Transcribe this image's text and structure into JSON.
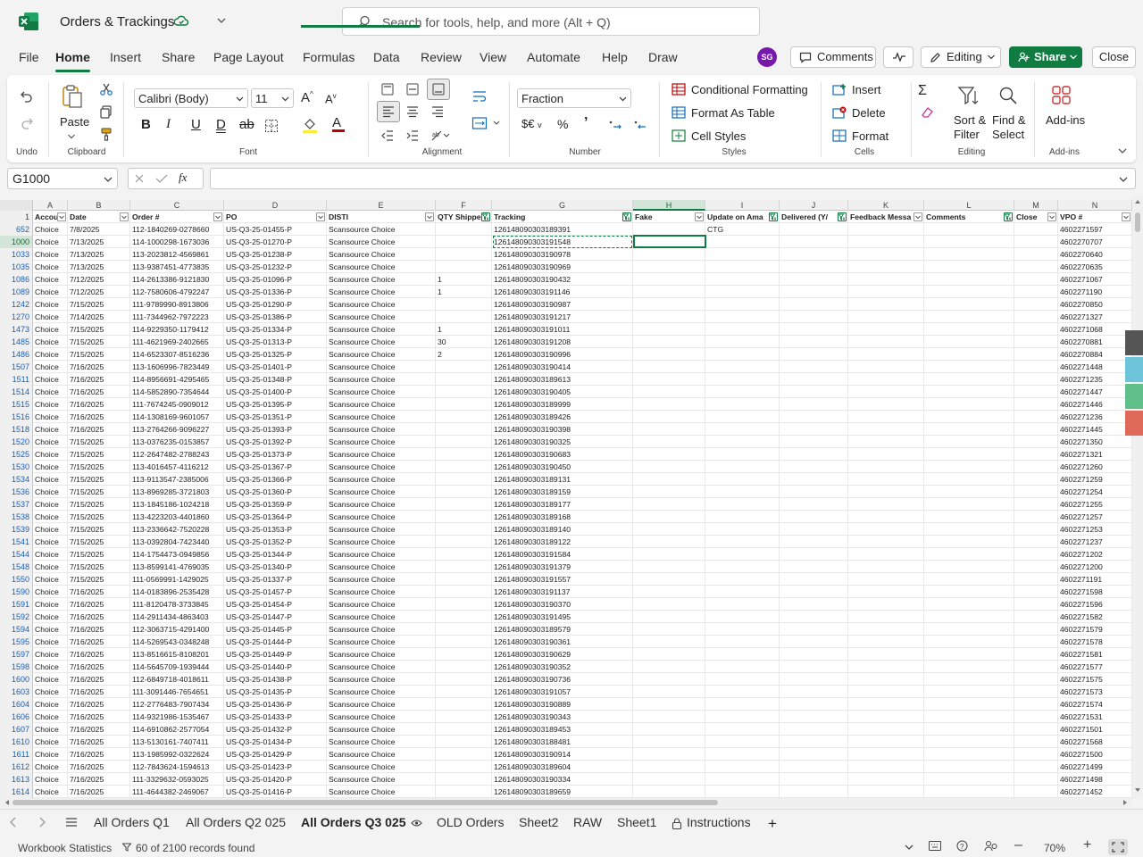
{
  "window": {
    "workbook_name": "Orders & Trackings",
    "search_placeholder": "Search for tools, help, and more (Alt + Q)"
  },
  "menu": {
    "tabs": [
      "File",
      "Home",
      "Insert",
      "Share",
      "Page Layout",
      "Formulas",
      "Data",
      "Review",
      "View",
      "Automate",
      "Help",
      "Draw"
    ],
    "active": "Home"
  },
  "header_actions": {
    "avatar": "SG",
    "comments": "Comments",
    "editing": "Editing",
    "share": "Share",
    "close": "Close"
  },
  "ribbon": {
    "undo_label": "Undo",
    "clipboard": {
      "paste": "Paste",
      "label": "Clipboard"
    },
    "font": {
      "name": "Calibri (Body)",
      "size": "11",
      "label": "Font"
    },
    "alignment": {
      "label": "Alignment"
    },
    "number": {
      "format": "Fraction",
      "label": "Number"
    },
    "styles": {
      "conditional": "Conditional Formatting",
      "format_table": "Format As Table",
      "cell_styles": "Cell Styles",
      "label": "Styles"
    },
    "cells": {
      "insert": "Insert",
      "delete": "Delete",
      "format": "Format",
      "label": "Cells"
    },
    "editing": {
      "sort_1": "Sort &",
      "sort_2": "Filter",
      "find_1": "Find &",
      "find_2": "Select",
      "label": "Editing"
    },
    "addins": {
      "name": "Add-ins",
      "label": "Add-ins"
    }
  },
  "formula_bar": {
    "name_box": "G1000",
    "formula": ""
  },
  "sheet": {
    "columns": [
      "A",
      "B",
      "C",
      "D",
      "E",
      "F",
      "G",
      "H",
      "I",
      "J",
      "K",
      "L",
      "M",
      "N"
    ],
    "selected_column": "H",
    "header_row_num": "1",
    "headers": [
      "Accou",
      "Date",
      "Order #",
      "PO",
      "DISTI",
      "QTY Shippe",
      "Tracking",
      "Fake",
      "Update on Ama",
      "Delivered (Y/",
      "Feedback Messa",
      "Comments",
      "Close",
      "VPO #"
    ],
    "active_row": "1000",
    "rows": [
      [
        "652",
        "Choice",
        "7/8/2025",
        "112-1840269-0278660",
        "US-Q3-25-01455-P",
        "Scansource Choice",
        "",
        "126148090303189391",
        "",
        "CTG",
        "",
        "",
        "",
        "",
        "4602271597"
      ],
      [
        "1000",
        "Choice",
        "7/13/2025",
        "114-1000298-1673036",
        "US-Q3-25-01270-P",
        "Scansource Choice",
        "",
        "126148090303191548",
        "",
        "",
        "",
        "",
        "",
        "",
        "4602270707"
      ],
      [
        "1033",
        "Choice",
        "7/13/2025",
        "113-2023812-4569861",
        "US-Q3-25-01238-P",
        "Scansource Choice",
        "",
        "126148090303190978",
        "",
        "",
        "",
        "",
        "",
        "",
        "4602270640"
      ],
      [
        "1035",
        "Choice",
        "7/13/2025",
        "113-9387451-4773835",
        "US-Q3-25-01232-P",
        "Scansource Choice",
        "",
        "126148090303190969",
        "",
        "",
        "",
        "",
        "",
        "",
        "4602270635"
      ],
      [
        "1086",
        "Choice",
        "7/12/2025",
        "114-2613386-9121830",
        "US-Q3-25-01096-P",
        "Scansource Choice",
        "1",
        "126148090303190432",
        "",
        "",
        "",
        "",
        "",
        "",
        "4602271067"
      ],
      [
        "1089",
        "Choice",
        "7/12/2025",
        "112-7580606-4792247",
        "US-Q3-25-01336-P",
        "Scansource Choice",
        "1",
        "126148090303191146",
        "",
        "",
        "",
        "",
        "",
        "",
        "4602271190"
      ],
      [
        "1242",
        "Choice",
        "7/15/2025",
        "111-9789990-8913806",
        "US-Q3-25-01290-P",
        "Scansource Choice",
        "",
        "126148090303190987",
        "",
        "",
        "",
        "",
        "",
        "",
        "4602270850"
      ],
      [
        "1270",
        "Choice",
        "7/14/2025",
        "111-7344962-7972223",
        "US-Q3-25-01386-P",
        "Scansource Choice",
        "",
        "126148090303191217",
        "",
        "",
        "",
        "",
        "",
        "",
        "4602271327"
      ],
      [
        "1473",
        "Choice",
        "7/15/2025",
        "114-9229350-1179412",
        "US-Q3-25-01334-P",
        "Scansource Choice",
        "1",
        "126148090303191011",
        "",
        "",
        "",
        "",
        "",
        "",
        "4602271068"
      ],
      [
        "1485",
        "Choice",
        "7/15/2025",
        "111-4621969-2402665",
        "US-Q3-25-01313-P",
        "Scansource Choice",
        "30",
        "126148090303191208",
        "",
        "",
        "",
        "",
        "",
        "",
        "4602270881"
      ],
      [
        "1486",
        "Choice",
        "7/15/2025",
        "114-6523307-8516236",
        "US-Q3-25-01325-P",
        "Scansource Choice",
        "2",
        "126148090303190996",
        "",
        "",
        "",
        "",
        "",
        "",
        "4602270884"
      ],
      [
        "1507",
        "Choice",
        "7/16/2025",
        "113-1606996-7823449",
        "US-Q3-25-01401-P",
        "Scansource Choice",
        "",
        "126148090303190414",
        "",
        "",
        "",
        "",
        "",
        "",
        "4602271448"
      ],
      [
        "1511",
        "Choice",
        "7/16/2025",
        "114-8956691-4295465",
        "US-Q3-25-01348-P",
        "Scansource Choice",
        "",
        "126148090303189613",
        "",
        "",
        "",
        "",
        "",
        "",
        "4602271235"
      ],
      [
        "1514",
        "Choice",
        "7/16/2025",
        "114-5852890-7354644",
        "US-Q3-25-01400-P",
        "Scansource Choice",
        "",
        "126148090303190405",
        "",
        "",
        "",
        "",
        "",
        "",
        "4602271447"
      ],
      [
        "1515",
        "Choice",
        "7/16/2025",
        "111-7674245-0909012",
        "US-Q3-25-01395-P",
        "Scansource Choice",
        "",
        "126148090303189999",
        "",
        "",
        "",
        "",
        "",
        "",
        "4602271446"
      ],
      [
        "1516",
        "Choice",
        "7/16/2025",
        "114-1308169-9601057",
        "US-Q3-25-01351-P",
        "Scansource Choice",
        "",
        "126148090303189426",
        "",
        "",
        "",
        "",
        "",
        "",
        "4602271236"
      ],
      [
        "1518",
        "Choice",
        "7/16/2025",
        "113-2764266-9096227",
        "US-Q3-25-01393-P",
        "Scansource Choice",
        "",
        "126148090303190398",
        "",
        "",
        "",
        "",
        "",
        "",
        "4602271445"
      ],
      [
        "1520",
        "Choice",
        "7/15/2025",
        "113-0376235-0153857",
        "US-Q3-25-01392-P",
        "Scansource Choice",
        "",
        "126148090303190325",
        "",
        "",
        "",
        "",
        "",
        "",
        "4602271350"
      ],
      [
        "1525",
        "Choice",
        "7/15/2025",
        "112-2647482-2788243",
        "US-Q3-25-01373-P",
        "Scansource Choice",
        "",
        "126148090303190683",
        "",
        "",
        "",
        "",
        "",
        "",
        "4602271321"
      ],
      [
        "1530",
        "Choice",
        "7/15/2025",
        "113-4016457-4116212",
        "US-Q3-25-01367-P",
        "Scansource Choice",
        "",
        "126148090303190450",
        "",
        "",
        "",
        "",
        "",
        "",
        "4602271260"
      ],
      [
        "1534",
        "Choice",
        "7/15/2025",
        "113-9113547-2385006",
        "US-Q3-25-01366-P",
        "Scansource Choice",
        "",
        "126148090303189131",
        "",
        "",
        "",
        "",
        "",
        "",
        "4602271259"
      ],
      [
        "1536",
        "Choice",
        "7/15/2025",
        "113-8969285-3721803",
        "US-Q3-25-01360-P",
        "Scansource Choice",
        "",
        "126148090303189159",
        "",
        "",
        "",
        "",
        "",
        "",
        "4602271254"
      ],
      [
        "1537",
        "Choice",
        "7/15/2025",
        "113-1845186-1024218",
        "US-Q3-25-01359-P",
        "Scansource Choice",
        "",
        "126148090303189177",
        "",
        "",
        "",
        "",
        "",
        "",
        "4602271255"
      ],
      [
        "1538",
        "Choice",
        "7/15/2025",
        "113-4223203-4401860",
        "US-Q3-25-01364-P",
        "Scansource Choice",
        "",
        "126148090303189168",
        "",
        "",
        "",
        "",
        "",
        "",
        "4602271257"
      ],
      [
        "1539",
        "Choice",
        "7/15/2025",
        "113-2336642-7520228",
        "US-Q3-25-01353-P",
        "Scansource Choice",
        "",
        "126148090303189140",
        "",
        "",
        "",
        "",
        "",
        "",
        "4602271253"
      ],
      [
        "1541",
        "Choice",
        "7/15/2025",
        "113-0392804-7423440",
        "US-Q3-25-01352-P",
        "Scansource Choice",
        "",
        "126148090303189122",
        "",
        "",
        "",
        "",
        "",
        "",
        "4602271237"
      ],
      [
        "1544",
        "Choice",
        "7/15/2025",
        "114-1754473-0949856",
        "US-Q3-25-01344-P",
        "Scansource Choice",
        "",
        "126148090303191584",
        "",
        "",
        "",
        "",
        "",
        "",
        "4602271202"
      ],
      [
        "1548",
        "Choice",
        "7/15/2025",
        "113-8599141-4769035",
        "US-Q3-25-01340-P",
        "Scansource Choice",
        "",
        "126148090303191379",
        "",
        "",
        "",
        "",
        "",
        "",
        "4602271200"
      ],
      [
        "1550",
        "Choice",
        "7/15/2025",
        "111-0569991-1429025",
        "US-Q3-25-01337-P",
        "Scansource Choice",
        "",
        "126148090303191557",
        "",
        "",
        "",
        "",
        "",
        "",
        "4602271191"
      ],
      [
        "1590",
        "Choice",
        "7/16/2025",
        "114-0183896-2535428",
        "US-Q3-25-01457-P",
        "Scansource Choice",
        "",
        "126148090303191137",
        "",
        "",
        "",
        "",
        "",
        "",
        "4602271598"
      ],
      [
        "1591",
        "Choice",
        "7/16/2025",
        "111-8120478-3733845",
        "US-Q3-25-01454-P",
        "Scansource Choice",
        "",
        "126148090303190370",
        "",
        "",
        "",
        "",
        "",
        "",
        "4602271596"
      ],
      [
        "1592",
        "Choice",
        "7/16/2025",
        "114-2911434-4863403",
        "US-Q3-25-01447-P",
        "Scansource Choice",
        "",
        "126148090303191495",
        "",
        "",
        "",
        "",
        "",
        "",
        "4602271582"
      ],
      [
        "1594",
        "Choice",
        "7/16/2025",
        "112-3063715-4291400",
        "US-Q3-25-01445-P",
        "Scansource Choice",
        "",
        "126148090303189579",
        "",
        "",
        "",
        "",
        "",
        "",
        "4602271579"
      ],
      [
        "1595",
        "Choice",
        "7/16/2025",
        "114-5269543-0348248",
        "US-Q3-25-01444-P",
        "Scansource Choice",
        "",
        "126148090303190361",
        "",
        "",
        "",
        "",
        "",
        "",
        "4602271578"
      ],
      [
        "1597",
        "Choice",
        "7/16/2025",
        "113-8516615-8108201",
        "US-Q3-25-01449-P",
        "Scansource Choice",
        "",
        "126148090303190629",
        "",
        "",
        "",
        "",
        "",
        "",
        "4602271581"
      ],
      [
        "1598",
        "Choice",
        "7/16/2025",
        "114-5645709-1939444",
        "US-Q3-25-01440-P",
        "Scansource Choice",
        "",
        "126148090303190352",
        "",
        "",
        "",
        "",
        "",
        "",
        "4602271577"
      ],
      [
        "1600",
        "Choice",
        "7/16/2025",
        "112-6849718-4018611",
        "US-Q3-25-01438-P",
        "Scansource Choice",
        "",
        "126148090303190736",
        "",
        "",
        "",
        "",
        "",
        "",
        "4602271575"
      ],
      [
        "1603",
        "Choice",
        "7/16/2025",
        "111-3091446-7654651",
        "US-Q3-25-01435-P",
        "Scansource Choice",
        "",
        "126148090303191057",
        "",
        "",
        "",
        "",
        "",
        "",
        "4602271573"
      ],
      [
        "1604",
        "Choice",
        "7/16/2025",
        "112-2776483-7907434",
        "US-Q3-25-01436-P",
        "Scansource Choice",
        "",
        "126148090303190889",
        "",
        "",
        "",
        "",
        "",
        "",
        "4602271574"
      ],
      [
        "1606",
        "Choice",
        "7/16/2025",
        "114-9321986-1535467",
        "US-Q3-25-01433-P",
        "Scansource Choice",
        "",
        "126148090303190343",
        "",
        "",
        "",
        "",
        "",
        "",
        "4602271531"
      ],
      [
        "1607",
        "Choice",
        "7/16/2025",
        "114-6910862-2577054",
        "US-Q3-25-01432-P",
        "Scansource Choice",
        "",
        "126148090303189453",
        "",
        "",
        "",
        "",
        "",
        "",
        "4602271501"
      ],
      [
        "1610",
        "Choice",
        "7/16/2025",
        "113-5130161-7407411",
        "US-Q3-25-01434-P",
        "Scansource Choice",
        "",
        "126148090303188481",
        "",
        "",
        "",
        "",
        "",
        "",
        "4602271568"
      ],
      [
        "1611",
        "Choice",
        "7/16/2025",
        "113-1985992-0322624",
        "US-Q3-25-01429-P",
        "Scansource Choice",
        "",
        "126148090303190914",
        "",
        "",
        "",
        "",
        "",
        "",
        "4602271500"
      ],
      [
        "1612",
        "Choice",
        "7/16/2025",
        "112-7843624-1594613",
        "US-Q3-25-01423-P",
        "Scansource Choice",
        "",
        "126148090303189604",
        "",
        "",
        "",
        "",
        "",
        "",
        "4602271499"
      ],
      [
        "1613",
        "Choice",
        "7/16/2025",
        "111-3329632-0593025",
        "US-Q3-25-01420-P",
        "Scansource Choice",
        "",
        "126148090303190334",
        "",
        "",
        "",
        "",
        "",
        "",
        "4602271498"
      ],
      [
        "1614",
        "Choice",
        "7/16/2025",
        "111-4644382-2469067",
        "US-Q3-25-01416-P",
        "Scansource Choice",
        "",
        "126148090303189659",
        "",
        "",
        "",
        "",
        "",
        "",
        "4602271452"
      ]
    ]
  },
  "sheet_tabs": {
    "tabs": [
      "All Orders Q1",
      "All Orders Q2 025",
      "All Orders Q3 025",
      "OLD Orders",
      "Sheet2",
      "RAW",
      "Sheet1",
      "Instructions"
    ],
    "active": "All Orders Q3 025"
  },
  "status": {
    "workbook_stats": "Workbook Statistics",
    "records": "60 of 2100 records found",
    "zoom": "70%"
  },
  "colors": {
    "accent": "#107c41",
    "avatar": "#7719aa"
  }
}
